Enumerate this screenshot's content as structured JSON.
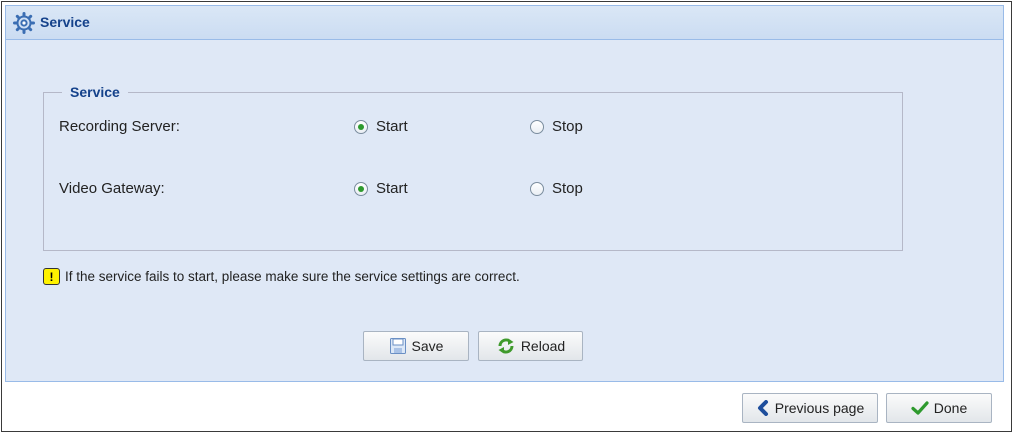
{
  "panel": {
    "title": "Service",
    "icon": "gear-icon"
  },
  "fieldset": {
    "legend": "Service"
  },
  "rows": [
    {
      "label": "Recording Server:",
      "options": [
        "Start",
        "Stop"
      ],
      "selected": "Start"
    },
    {
      "label": "Video Gateway:",
      "options": [
        "Start",
        "Stop"
      ],
      "selected": "Start"
    }
  ],
  "note": {
    "text": "If the service fails to start, please make sure the service settings are correct.",
    "icon": "warning-icon"
  },
  "buttons": {
    "save": "Save",
    "reload": "Reload"
  },
  "footer": {
    "previous": "Previous page",
    "done": "Done"
  },
  "colors": {
    "title": "#15428b",
    "panel_bg": "#dfe8f6",
    "radio_selected": "#2e9a2e"
  }
}
